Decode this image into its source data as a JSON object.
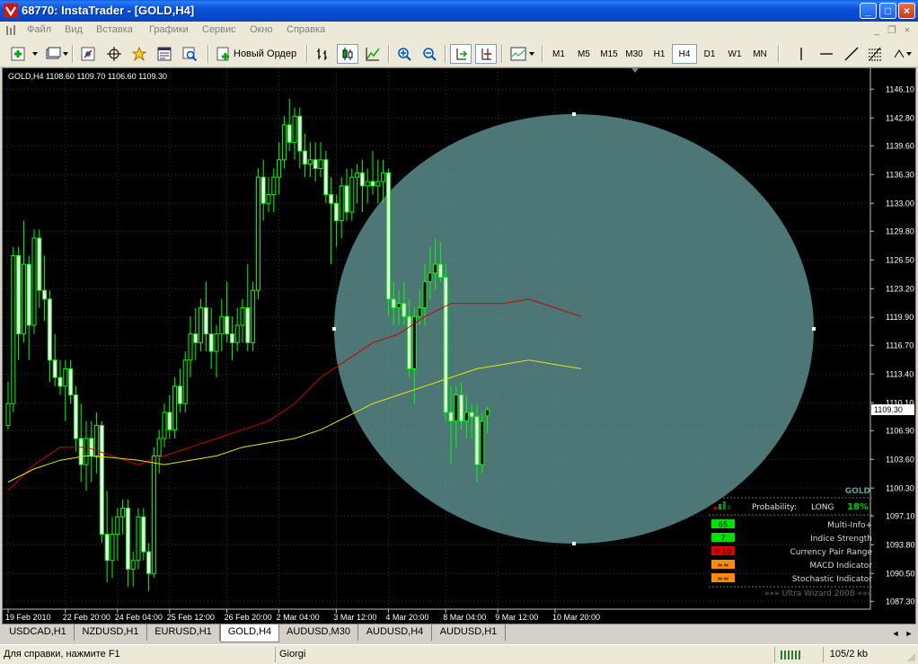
{
  "window": {
    "title": "68770: InstaTrader - [GOLD,H4]",
    "minimize": "_",
    "maximize": "□",
    "close": "×"
  },
  "menu": {
    "items": [
      "Файл",
      "Вид",
      "Вставка",
      "Графики",
      "Сервис",
      "Окно",
      "Справка"
    ],
    "mdi_minimize": "_",
    "mdi_restore": "❐",
    "mdi_close": "×"
  },
  "toolbar": {
    "new_order": "Новый Ордер",
    "timeframes": [
      "M1",
      "M5",
      "M15",
      "M30",
      "H1",
      "H4",
      "D1",
      "W1",
      "MN"
    ],
    "active_timeframe": "H4"
  },
  "chart_data": {
    "type": "candlestick",
    "symbol": "GOLD,H4",
    "ohlc_header": "GOLD,H4  1108.60 1109.70 1106.60 1109.30",
    "current_price": 1109.3,
    "ylim": [
      1086.4,
      1148.5
    ],
    "y_ticks": [
      1146.1,
      1142.8,
      1139.6,
      1136.3,
      1133.0,
      1129.8,
      1126.5,
      1123.2,
      1119.9,
      1116.7,
      1113.4,
      1110.1,
      1106.9,
      1103.6,
      1100.3,
      1097.1,
      1093.8,
      1090.5,
      1087.3
    ],
    "x_labels": [
      {
        "label": "19 Feb 2010",
        "bar": 0
      },
      {
        "label": "22 Feb 20:00",
        "bar": 11
      },
      {
        "label": "24 Feb 04:00",
        "bar": 21
      },
      {
        "label": "25 Feb 12:00",
        "bar": 31
      },
      {
        "label": "26 Feb 20:00",
        "bar": 42
      },
      {
        "label": "2 Mar 04:00",
        "bar": 52
      },
      {
        "label": "3 Mar 12:00",
        "bar": 63
      },
      {
        "label": "4 Mar 20:00",
        "bar": 73
      },
      {
        "label": "8 Mar 04:00",
        "bar": 84
      },
      {
        "label": "9 Mar 12:00",
        "bar": 94
      },
      {
        "label": "10 Mar 20:00",
        "bar": 105
      }
    ],
    "candles": [
      [
        1107.5,
        1112.5,
        1107.0,
        1110.0
      ],
      [
        1110.0,
        1128.0,
        1109.0,
        1127.0
      ],
      [
        1127.0,
        1128.0,
        1115.0,
        1118.0
      ],
      [
        1118.0,
        1131.0,
        1117.0,
        1126.0
      ],
      [
        1126.0,
        1127.0,
        1115.0,
        1119.0
      ],
      [
        1119.0,
        1130.0,
        1118.0,
        1129.0
      ],
      [
        1129.0,
        1130.0,
        1121.0,
        1123.0
      ],
      [
        1123.0,
        1127.0,
        1119.5,
        1122.0
      ],
      [
        1122.0,
        1123.0,
        1112.5,
        1115.0
      ],
      [
        1115.0,
        1118.0,
        1112.0,
        1113.0
      ],
      [
        1113.0,
        1115.0,
        1111.0,
        1112.0
      ],
      [
        1112.0,
        1115.0,
        1108.0,
        1114.0
      ],
      [
        1114.0,
        1115.0,
        1110.0,
        1111.0
      ],
      [
        1111.0,
        1112.0,
        1104.5,
        1106.0
      ],
      [
        1106.0,
        1110.0,
        1101.0,
        1103.0
      ],
      [
        1103.0,
        1108.0,
        1100.0,
        1106.0
      ],
      [
        1106.0,
        1108.0,
        1101.0,
        1104.0
      ],
      [
        1104.0,
        1109.0,
        1102.0,
        1107.5
      ],
      [
        1107.5,
        1108.0,
        1094.0,
        1095.0
      ],
      [
        1095.0,
        1100.0,
        1089.5,
        1092.0
      ],
      [
        1092.0,
        1097.0,
        1090.0,
        1095.0
      ],
      [
        1095.0,
        1098.0,
        1092.0,
        1097.0
      ],
      [
        1097.0,
        1099.0,
        1095.0,
        1098.0
      ],
      [
        1098.0,
        1099.0,
        1089.0,
        1091.0
      ],
      [
        1091.0,
        1093.0,
        1089.0,
        1092.0
      ],
      [
        1092.0,
        1098.0,
        1091.0,
        1097.0
      ],
      [
        1097.0,
        1098.0,
        1092.0,
        1093.0
      ],
      [
        1093.0,
        1094.0,
        1088.5,
        1090.5
      ],
      [
        1090.5,
        1105.0,
        1090.0,
        1104.0
      ],
      [
        1104.0,
        1107.0,
        1102.0,
        1106.0
      ],
      [
        1106.0,
        1110.0,
        1105.0,
        1109.0
      ],
      [
        1109.0,
        1111.0,
        1106.0,
        1107.0
      ],
      [
        1107.0,
        1113.0,
        1106.0,
        1112.0
      ],
      [
        1112.0,
        1114.0,
        1109.0,
        1110.0
      ],
      [
        1110.0,
        1116.0,
        1109.0,
        1115.0
      ],
      [
        1115.0,
        1120.0,
        1113.0,
        1118.0
      ],
      [
        1118.0,
        1121.0,
        1115.0,
        1117.0
      ],
      [
        1117.0,
        1122.0,
        1116.0,
        1121.0
      ],
      [
        1121.0,
        1124.0,
        1116.0,
        1118.0
      ],
      [
        1118.0,
        1121.0,
        1114.0,
        1116.0
      ],
      [
        1116.0,
        1119.0,
        1113.0,
        1118.0
      ],
      [
        1118.0,
        1122.0,
        1116.0,
        1120.0
      ],
      [
        1120.0,
        1124.0,
        1117.0,
        1118.0
      ],
      [
        1118.0,
        1120.0,
        1115.0,
        1117.0
      ],
      [
        1117.0,
        1121.0,
        1116.0,
        1119.0
      ],
      [
        1119.0,
        1122.0,
        1117.0,
        1121.0
      ],
      [
        1121.0,
        1126.0,
        1116.0,
        1117.0
      ],
      [
        1117.0,
        1124.0,
        1116.0,
        1123.0
      ],
      [
        1123.0,
        1137.0,
        1122.0,
        1136.0
      ],
      [
        1136.0,
        1138.0,
        1131.0,
        1133.0
      ],
      [
        1133.0,
        1136.0,
        1132.0,
        1134.0
      ],
      [
        1134.0,
        1137.0,
        1132.0,
        1136.0
      ],
      [
        1136.0,
        1140.0,
        1134.0,
        1138.0
      ],
      [
        1138.0,
        1143.0,
        1137.0,
        1142.0
      ],
      [
        1142.0,
        1145.0,
        1139.0,
        1140.0
      ],
      [
        1140.0,
        1144.0,
        1138.0,
        1143.0
      ],
      [
        1143.0,
        1144.0,
        1137.0,
        1139.0
      ],
      [
        1139.0,
        1141.0,
        1136.0,
        1137.5
      ],
      [
        1137.5,
        1140.0,
        1136.0,
        1138.0
      ],
      [
        1138.0,
        1140.0,
        1135.5,
        1137.0
      ],
      [
        1137.0,
        1140.0,
        1136.0,
        1138.0
      ],
      [
        1138.0,
        1139.0,
        1133.0,
        1134.0
      ],
      [
        1134.0,
        1136.0,
        1126.0,
        1133.0
      ],
      [
        1133.0,
        1134.0,
        1128.0,
        1131.0
      ],
      [
        1131.0,
        1136.0,
        1129.0,
        1135.0
      ],
      [
        1135.0,
        1137.0,
        1131.0,
        1132.0
      ],
      [
        1132.0,
        1137.0,
        1131.0,
        1136.0
      ],
      [
        1136.0,
        1137.5,
        1133.0,
        1136.5
      ],
      [
        1136.5,
        1138.0,
        1132.0,
        1135.0
      ],
      [
        1135.0,
        1137.0,
        1133.0,
        1135.5
      ],
      [
        1135.5,
        1139.0,
        1134.0,
        1135.0
      ],
      [
        1135.0,
        1138.0,
        1133.0,
        1135.5
      ],
      [
        1135.5,
        1138.0,
        1133.0,
        1136.5
      ],
      [
        1136.5,
        1137.0,
        1120.0,
        1122.0
      ],
      [
        1122.0,
        1124.0,
        1119.0,
        1121.0
      ],
      [
        1121.0,
        1123.0,
        1119.0,
        1121.5
      ],
      [
        1121.5,
        1124.0,
        1119.0,
        1120.0
      ],
      [
        1120.0,
        1122.0,
        1113.0,
        1114.0
      ],
      [
        1114.0,
        1121.0,
        1110.0,
        1120.0
      ],
      [
        1120.0,
        1123.0,
        1119.0,
        1121.0
      ],
      [
        1121.0,
        1126.0,
        1119.0,
        1124.0
      ],
      [
        1124.0,
        1128.0,
        1122.0,
        1125.0
      ],
      [
        1125.0,
        1129.0,
        1123.0,
        1126.0
      ],
      [
        1126.0,
        1128.5,
        1124.0,
        1124.5
      ],
      [
        1124.5,
        1126.0,
        1108.0,
        1109.0
      ],
      [
        1109.0,
        1112.0,
        1103.0,
        1108.0
      ],
      [
        1108.0,
        1112.0,
        1105.0,
        1111.0
      ],
      [
        1111.0,
        1112.5,
        1107.0,
        1108.0
      ],
      [
        1108.0,
        1111.0,
        1106.0,
        1109.0
      ],
      [
        1109.0,
        1110.0,
        1106.0,
        1108.5
      ],
      [
        1108.5,
        1110.0,
        1101.0,
        1103.0
      ],
      [
        1103.0,
        1109.0,
        1102.0,
        1108.0
      ],
      [
        1108.6,
        1109.7,
        1106.6,
        1109.3
      ]
    ],
    "ma_red": [
      [
        0,
        1100
      ],
      [
        5,
        1103
      ],
      [
        10,
        1105
      ],
      [
        15,
        1105
      ],
      [
        20,
        1104
      ],
      [
        25,
        1103
      ],
      [
        30,
        1104
      ],
      [
        35,
        1105
      ],
      [
        40,
        1106
      ],
      [
        45,
        1107
      ],
      [
        50,
        1108
      ],
      [
        55,
        1110
      ],
      [
        60,
        1113
      ],
      [
        65,
        1115
      ],
      [
        70,
        1117
      ],
      [
        75,
        1118
      ],
      [
        80,
        1120
      ],
      [
        85,
        1121.5
      ],
      [
        90,
        1121.5
      ],
      [
        95,
        1121.5
      ],
      [
        100,
        1122
      ],
      [
        105,
        1121
      ],
      [
        110,
        1120
      ]
    ],
    "ma_yellow": [
      [
        0,
        1101
      ],
      [
        5,
        1102.5
      ],
      [
        10,
        1103.5
      ],
      [
        15,
        1104
      ],
      [
        20,
        1103.8
      ],
      [
        25,
        1103.5
      ],
      [
        30,
        1103
      ],
      [
        35,
        1103.5
      ],
      [
        40,
        1104
      ],
      [
        45,
        1105
      ],
      [
        50,
        1105.5
      ],
      [
        55,
        1106
      ],
      [
        60,
        1107
      ],
      [
        65,
        1108.5
      ],
      [
        70,
        1110
      ],
      [
        75,
        1111
      ],
      [
        80,
        1112
      ],
      [
        85,
        1113
      ],
      [
        90,
        1114
      ],
      [
        95,
        1114.5
      ],
      [
        100,
        1115
      ],
      [
        105,
        1114.5
      ],
      [
        110,
        1114
      ]
    ],
    "grid": true
  },
  "indicator_panel": {
    "symbol": "GOLD",
    "probability_label": "Probability:",
    "direction": "LONG",
    "percent": "18%",
    "rows": [
      {
        "value": "65",
        "label": "Multi-Info+",
        "color": "#00e000"
      },
      {
        "value": "7",
        "label": "Indice Strength",
        "color": "#00e000"
      },
      {
        "value": "0 10",
        "label": "Currency Pair Range",
        "color": "#e00000"
      },
      {
        "value": "≈≈",
        "label": "MACD Indicator",
        "color": "#ff8c00"
      },
      {
        "value": "≈≈",
        "label": "Stochastic Indicator",
        "color": "#ff8c00"
      }
    ],
    "footer": "»»» Ultra Wizard 2008 «««"
  },
  "tabs": {
    "items": [
      "USDCAD,H1",
      "NZDUSD,H1",
      "EURUSD,H1",
      "GOLD,H4",
      "AUDUSD,M30",
      "AUDUSD,H4",
      "AUDUSD,H1"
    ],
    "active": "GOLD,H4"
  },
  "status": {
    "help": "Для справки, нажмите F1",
    "profile": "Giorgi",
    "traffic": "105/2 kb"
  },
  "colors": {
    "candle": "#00ff00",
    "ma_red": "#cc0000",
    "ma_yellow": "#e6e600",
    "grid": "#1e3c3c",
    "ellipse": "#5a8c8c",
    "price_label": "#ffffff"
  }
}
